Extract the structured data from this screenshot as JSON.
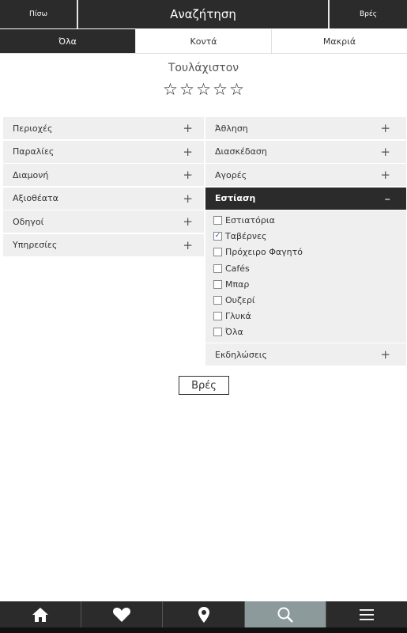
{
  "header": {
    "back_label": "Πίσω",
    "title": "Αναζήτηση",
    "find_label": "Βρές"
  },
  "tabs": [
    {
      "label": "Όλα",
      "active": true
    },
    {
      "label": "Κοντά",
      "active": false
    },
    {
      "label": "Μακριά",
      "active": false
    }
  ],
  "rating": {
    "label": "Τουλάχιστον",
    "stars": 5,
    "selected": 0
  },
  "left_categories": [
    {
      "label": "Περιοχές",
      "icon": "+"
    },
    {
      "label": "Παραλίες",
      "icon": "+"
    },
    {
      "label": "Διαμονή",
      "icon": "+"
    },
    {
      "label": "Αξιοθέατα",
      "icon": "+"
    },
    {
      "label": "Οδηγοί",
      "icon": "+"
    },
    {
      "label": "Υπηρεσίες",
      "icon": "+"
    }
  ],
  "right_categories": [
    {
      "label": "Άθληση",
      "icon": "+"
    },
    {
      "label": "Διασκέδαση",
      "icon": "+"
    },
    {
      "label": "Αγορές",
      "icon": "+"
    },
    {
      "label": "Εστίαση",
      "icon": "–"
    },
    {
      "label": "Εκδηλώσεις",
      "icon": "+"
    }
  ],
  "dining_options": [
    {
      "label": "Εστιατόρια",
      "checked": false
    },
    {
      "label": "Ταβέρνες",
      "checked": true
    },
    {
      "label": "Πρόχειρο Φαγητό",
      "checked": false
    },
    {
      "label": "Cafés",
      "checked": false
    },
    {
      "label": "Μπαρ",
      "checked": false
    },
    {
      "label": "Ουζερί",
      "checked": false
    },
    {
      "label": "Γλυκά",
      "checked": false
    },
    {
      "label": "Όλα",
      "checked": false
    }
  ],
  "search_button": {
    "label": "Βρές"
  },
  "bottom_nav": [
    {
      "icon": "home-icon",
      "active": false
    },
    {
      "icon": "heart-icon",
      "active": false
    },
    {
      "icon": "location-pin-icon",
      "active": false
    },
    {
      "icon": "search-icon",
      "active": true
    },
    {
      "icon": "menu-icon",
      "active": false
    }
  ],
  "colors": {
    "dark": "#2b2b2b",
    "row_bg": "#efefef",
    "active_nav": "#8c9a9c"
  }
}
